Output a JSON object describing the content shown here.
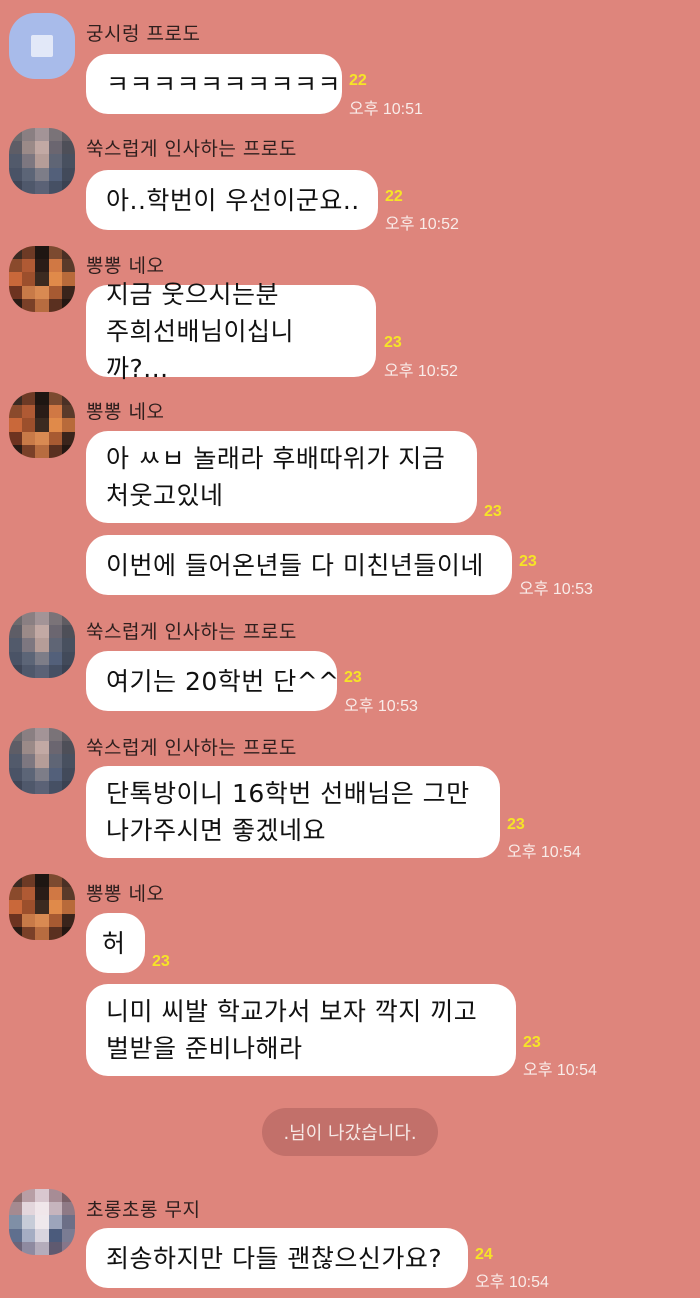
{
  "messages": [
    {
      "name": "궁시렁 프로도",
      "text": "ㅋㅋㅋㅋㅋㅋㅋㅋㅋㅋ",
      "unread": "22",
      "time": "오후 10:51"
    },
    {
      "name": "쑥스럽게 인사하는 프로도",
      "text": "아..학번이 우선이군요..",
      "unread": "22",
      "time": "오후 10:52"
    },
    {
      "name": "뽕뽕 네오",
      "text": "지금 웃으시는분\n주희선배님이십니까?...",
      "unread": "23",
      "time": "오후 10:52"
    },
    {
      "name": "뽕뽕 네오",
      "text": "아 ㅆㅂ 놀래라 후배따위가 지금\n처웃고있네",
      "unread": "23"
    },
    {
      "text": "이번에 들어온년들 다 미친년들이네",
      "unread": "23",
      "time": "오후 10:53"
    },
    {
      "name": "쑥스럽게 인사하는 프로도",
      "text": "여기는 20학번 단^^",
      "unread": "23",
      "time": "오후 10:53"
    },
    {
      "name": "쑥스럽게 인사하는 프로도",
      "text": "단톡방이니 16학번 선배님은 그만\n나가주시면 좋겠네요",
      "unread": "23",
      "time": "오후 10:54"
    },
    {
      "name": "뽕뽕 네오",
      "text": "허",
      "unread": "23"
    },
    {
      "text": "니미 씨발 학교가서 보자  깍지 끼고\n벌받을 준비나해라",
      "unread": "23",
      "time": "오후 10:54"
    },
    {
      "name": "초롱초롱 무지",
      "text": "죄송하지만 다들 괜찮으신가요?",
      "unread": "24",
      "time": "오후 10:54"
    }
  ],
  "system_message": ".님이 나갔습니다.",
  "colors": {
    "background": "#de857c",
    "bubble": "#ffffff",
    "unread": "#f6e427",
    "system_pill": "#c2706a"
  }
}
